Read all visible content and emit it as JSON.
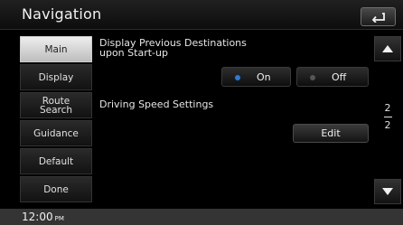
{
  "header": {
    "title": "Navigation"
  },
  "colors": {
    "on_dot": "#2a7bd4",
    "off_dot": "#555555"
  },
  "sidebar": {
    "items": [
      {
        "label": "Main",
        "active": true
      },
      {
        "label": "Display",
        "active": false
      },
      {
        "label": "Route\nSearch",
        "active": false
      },
      {
        "label": "Guidance",
        "active": false
      },
      {
        "label": "Default",
        "active": false
      },
      {
        "label": "Done",
        "active": false
      }
    ]
  },
  "main": {
    "prev_dest_label": "Display Previous Destinations\nupon Start-up",
    "on_label": "On",
    "off_label": "Off",
    "selected": "On",
    "speed_label": "Driving Speed Settings",
    "edit_label": "Edit"
  },
  "pager": {
    "current": "2",
    "total": "2"
  },
  "status": {
    "time": "12:00",
    "ampm": "PM"
  }
}
